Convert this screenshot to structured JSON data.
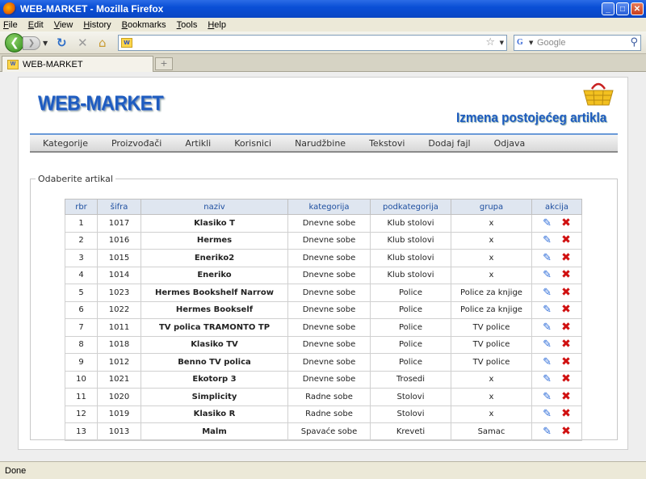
{
  "window": {
    "title": "WEB-MARKET - Mozilla Firefox"
  },
  "menu": [
    "File",
    "Edit",
    "View",
    "History",
    "Bookmarks",
    "Tools",
    "Help"
  ],
  "toolbar": {
    "url": "",
    "search_placeholder": "Google"
  },
  "tab": {
    "title": "WEB-MARKET"
  },
  "site": {
    "logo": "WEB-MARKET",
    "heading": "Izmena postojećeg artikla",
    "nav": [
      "Kategorije",
      "Proizvođači",
      "Artikli",
      "Korisnici",
      "Narudžbine",
      "Tekstovi",
      "Dodaj fajl",
      "Odjava"
    ],
    "section_legend": "Odaberite artikal"
  },
  "table": {
    "headers": [
      "rbr",
      "šifra",
      "naziv",
      "kategorija",
      "podkategorija",
      "grupa",
      "akcija"
    ],
    "rows": [
      [
        "1",
        "1017",
        "Klasiko T",
        "Dnevne sobe",
        "Klub stolovi",
        "x"
      ],
      [
        "2",
        "1016",
        "Hermes",
        "Dnevne sobe",
        "Klub stolovi",
        "x"
      ],
      [
        "3",
        "1015",
        "Eneriko2",
        "Dnevne sobe",
        "Klub stolovi",
        "x"
      ],
      [
        "4",
        "1014",
        "Eneriko",
        "Dnevne sobe",
        "Klub stolovi",
        "x"
      ],
      [
        "5",
        "1023",
        "Hermes Bookshelf Narrow",
        "Dnevne sobe",
        "Police",
        "Police za knjige"
      ],
      [
        "6",
        "1022",
        "Hermes Bookself",
        "Dnevne sobe",
        "Police",
        "Police za knjige"
      ],
      [
        "7",
        "1011",
        "TV polica TRAMONTO TP",
        "Dnevne sobe",
        "Police",
        "TV police"
      ],
      [
        "8",
        "1018",
        "Klasiko TV",
        "Dnevne sobe",
        "Police",
        "TV police"
      ],
      [
        "9",
        "1012",
        "Benno TV polica",
        "Dnevne sobe",
        "Police",
        "TV police"
      ],
      [
        "10",
        "1021",
        "Ekotorp 3",
        "Dnevne sobe",
        "Trosedi",
        "x"
      ],
      [
        "11",
        "1020",
        "Simplicity",
        "Radne sobe",
        "Stolovi",
        "x"
      ],
      [
        "12",
        "1019",
        "Klasiko R",
        "Radne sobe",
        "Stolovi",
        "x"
      ],
      [
        "13",
        "1013",
        "Malm",
        "Spavaće sobe",
        "Kreveti",
        "Samac"
      ]
    ]
  },
  "status": {
    "text": "Done"
  }
}
